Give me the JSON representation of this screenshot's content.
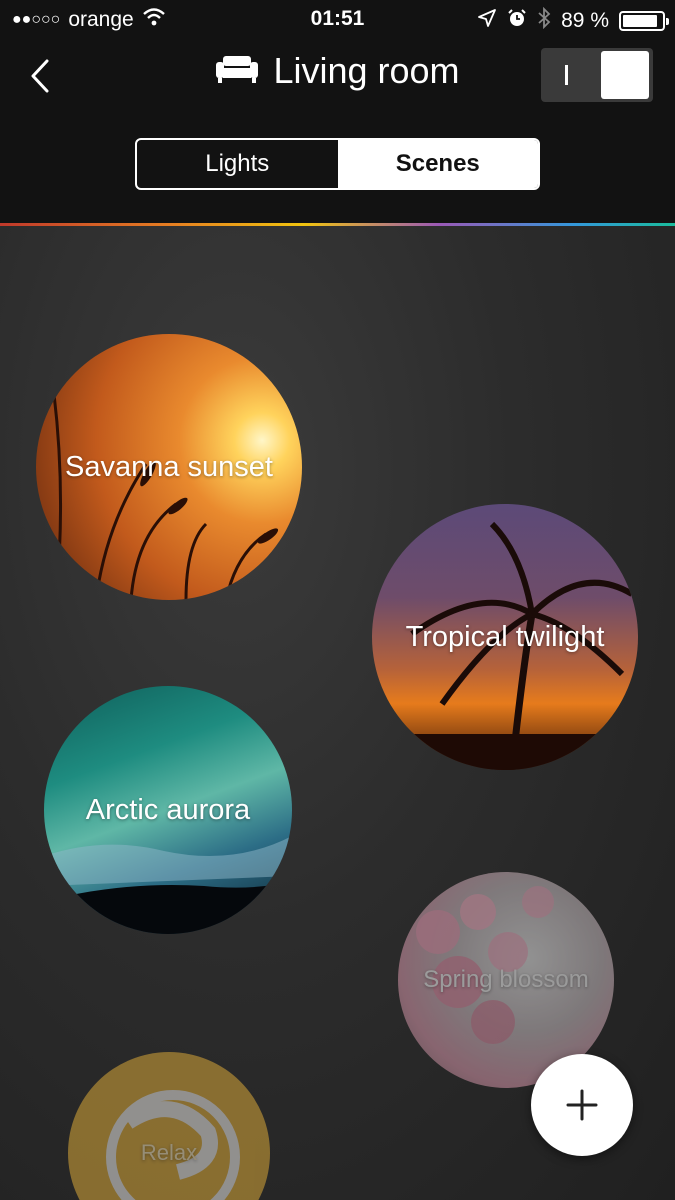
{
  "status_bar": {
    "signal": "●●○○○",
    "carrier": "orange",
    "time": "01:51",
    "battery_text": "89 %",
    "battery_level": 0.89,
    "icons": [
      "wifi-icon",
      "location-arrow-icon",
      "alarm-icon",
      "bluetooth-icon",
      "battery-icon"
    ]
  },
  "header": {
    "title": "Living room",
    "room_icon": "sofa-icon",
    "back_icon": "chevron-left-icon",
    "power_toggle": {
      "state": "on",
      "on_label": "I"
    }
  },
  "tabs": [
    {
      "label": "Lights",
      "active": false
    },
    {
      "label": "Scenes",
      "active": true
    }
  ],
  "scenes": [
    {
      "label": "Savanna sunset"
    },
    {
      "label": "Tropical twilight"
    },
    {
      "label": "Arctic aurora"
    },
    {
      "label": "Spring blossom"
    },
    {
      "label": "Relax"
    }
  ],
  "fab": {
    "icon": "plus-icon"
  },
  "colors": {
    "background": "#111111",
    "content_bg": "#2c2c2c",
    "accent": "#ffffff"
  }
}
